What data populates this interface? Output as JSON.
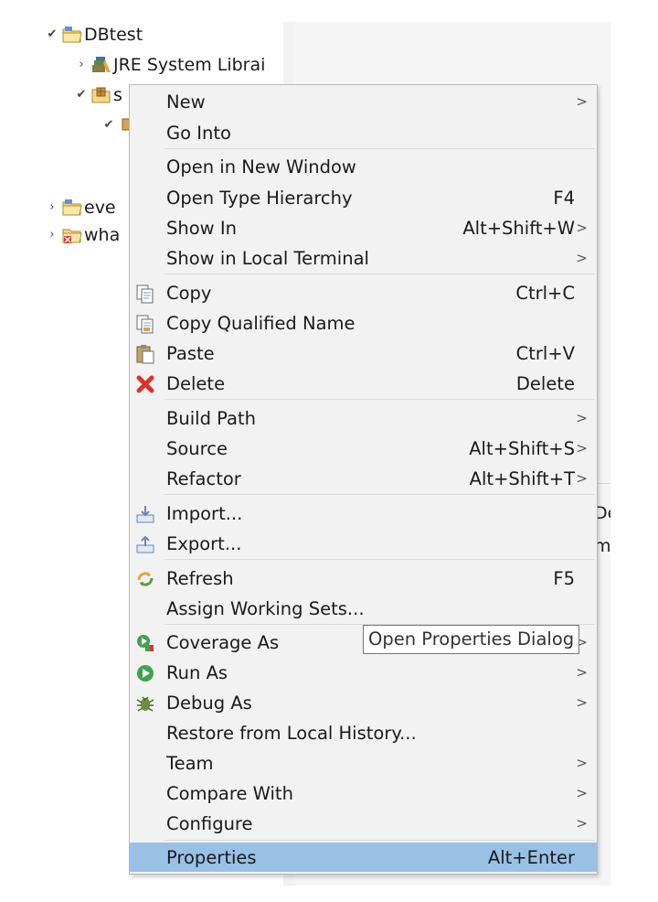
{
  "tree": {
    "items": [
      {
        "label": "DBtest",
        "icon": "project-folder-icon",
        "expanded": true
      },
      {
        "label": "JRE System Librai",
        "icon": "library-icon",
        "expanded": false
      },
      {
        "label": "s",
        "icon": "package-folder-icon",
        "expanded": true
      },
      {
        "label": "",
        "icon": "package-icon",
        "expanded": true
      },
      {
        "label": "eve",
        "icon": "project-folder-icon",
        "expanded": false
      },
      {
        "label": "wha",
        "icon": "project-folder-error-icon",
        "expanded": false
      }
    ]
  },
  "panel_clip": {
    "line1": "De",
    "line2": "m"
  },
  "menu": {
    "items": [
      {
        "label": "New",
        "shortcut": "",
        "submenu": true
      },
      {
        "label": "Go Into",
        "shortcut": "",
        "submenu": false
      },
      {
        "label": "Open in New Window",
        "shortcut": "",
        "submenu": false
      },
      {
        "label": "Open Type Hierarchy",
        "shortcut": "F4",
        "submenu": false
      },
      {
        "label": "Show In",
        "shortcut": "Alt+Shift+W",
        "submenu": true
      },
      {
        "label": "Show in Local Terminal",
        "shortcut": "",
        "submenu": true
      },
      {
        "label": "Copy",
        "shortcut": "Ctrl+C",
        "submenu": false,
        "icon": "copy-icon"
      },
      {
        "label": "Copy Qualified Name",
        "shortcut": "",
        "submenu": false,
        "icon": "copy-qualified-name-icon"
      },
      {
        "label": "Paste",
        "shortcut": "Ctrl+V",
        "submenu": false,
        "icon": "paste-icon"
      },
      {
        "label": "Delete",
        "shortcut": "Delete",
        "submenu": false,
        "icon": "delete-icon"
      },
      {
        "label": "Build Path",
        "shortcut": "",
        "submenu": true
      },
      {
        "label": "Source",
        "shortcut": "Alt+Shift+S",
        "submenu": true
      },
      {
        "label": "Refactor",
        "shortcut": "Alt+Shift+T",
        "submenu": true
      },
      {
        "label": "Import...",
        "shortcut": "",
        "submenu": false,
        "icon": "import-icon"
      },
      {
        "label": "Export...",
        "shortcut": "",
        "submenu": false,
        "icon": "export-icon"
      },
      {
        "label": "Refresh",
        "shortcut": "F5",
        "submenu": false,
        "icon": "refresh-icon"
      },
      {
        "label": "Assign Working Sets...",
        "shortcut": "",
        "submenu": false
      },
      {
        "label": "Coverage As",
        "shortcut": "",
        "submenu": true,
        "icon": "coverage-icon"
      },
      {
        "label": "Run As",
        "shortcut": "",
        "submenu": true,
        "icon": "run-icon"
      },
      {
        "label": "Debug As",
        "shortcut": "",
        "submenu": true,
        "icon": "debug-icon"
      },
      {
        "label": "Restore from Local History...",
        "shortcut": "",
        "submenu": false
      },
      {
        "label": "Team",
        "shortcut": "",
        "submenu": true
      },
      {
        "label": "Compare With",
        "shortcut": "",
        "submenu": true
      },
      {
        "label": "Configure",
        "shortcut": "",
        "submenu": true
      },
      {
        "label": "Properties",
        "shortcut": "Alt+Enter",
        "submenu": false,
        "selected": true
      }
    ],
    "submenu_arrow": ">"
  },
  "tooltip": {
    "text": "Open Properties Dialog"
  },
  "colors": {
    "selection": "#99c1e6",
    "menu_bg": "#f2f2f2",
    "delete_red": "#d9342b",
    "run_green": "#3fa34d"
  }
}
